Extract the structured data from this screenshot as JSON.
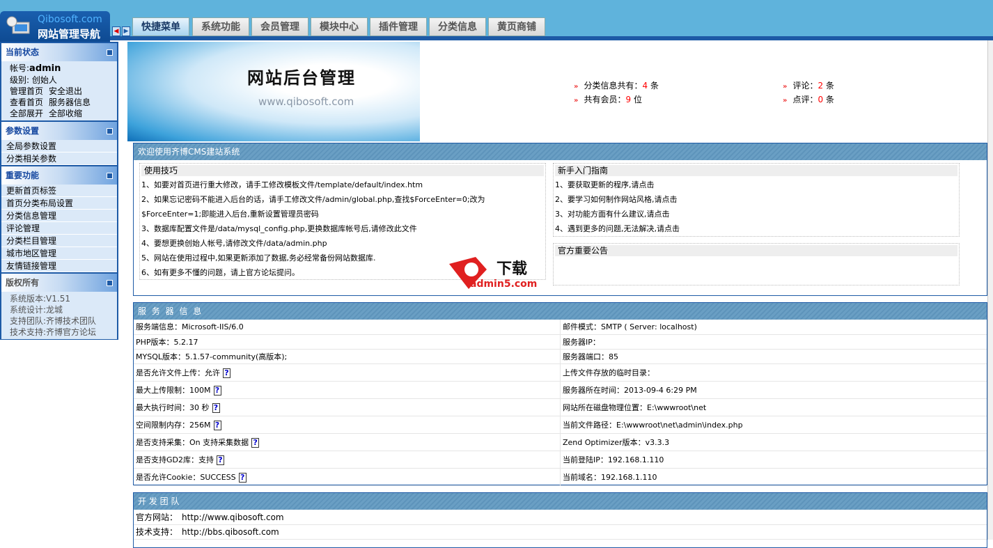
{
  "header": {
    "logo_en": "Qibosoft.com",
    "logo_cn": "网站管理导航",
    "tabs": [
      "快捷菜单",
      "系统功能",
      "会员管理",
      "模块中心",
      "插件管理",
      "分类信息",
      "黄页商铺"
    ],
    "active_tab": 0
  },
  "sidebar": {
    "status": {
      "title": "当前状态",
      "account_label": "帐号:",
      "account": "admin",
      "level": "级别:  创始人",
      "links": [
        [
          "管理首页",
          "安全退出"
        ],
        [
          "查看首页",
          "服务器信息"
        ],
        [
          "全部展开",
          "全部收缩"
        ]
      ]
    },
    "params": {
      "title": "参数设置",
      "items": [
        "全局参数设置",
        "分类相关参数"
      ]
    },
    "important": {
      "title": "重要功能",
      "items": [
        "更新首页标签",
        "首页分类布局设置",
        "分类信息管理",
        "评论管理",
        "分类栏目管理",
        "城市地区管理",
        "友情链接管理"
      ]
    },
    "copyright": {
      "title": "版权所有",
      "lines": [
        "系统版本:V1.51",
        "系统设计:龙城",
        "支持团队:齐博技术团队",
        "技术支持:齐博官方论坛"
      ]
    }
  },
  "banner": {
    "title": "网站后台管理",
    "url": "www.qibosoft.com"
  },
  "stats": [
    {
      "label": "分类信息共有：",
      "value": "4",
      "unit": " 条"
    },
    {
      "label": "共有会员：",
      "value": "9",
      "unit": " 位"
    },
    {
      "label": "评论：",
      "value": "2",
      "unit": " 条"
    },
    {
      "label": "点评：",
      "value": "0",
      "unit": " 条"
    }
  ],
  "welcome": {
    "title": "欢迎使用齐博CMS建站系统",
    "tips": {
      "title": "使用技巧",
      "lines": [
        "1、如要对首页进行重大修改，请手工修改模板文件/template/default/index.htm",
        "2、如果忘记密码不能进入后台的话，请手工修改文件/admin/global.php,查找$ForceEnter=0;改为",
        "$ForceEnter=1;即能进入后台,重新设置管理员密码",
        "3、数据库配置文件是/data/mysql_config.php,更换数据库帐号后,请修改此文件",
        "4、要想更换创始人帐号,请修改文件/data/admin.php",
        "5、网站在使用过程中,如果更新添加了数据,务必经常备份网站数据库.",
        "6、如有更多不懂的问题，请上官方论坛提问。"
      ]
    },
    "guide": {
      "title": "新手入门指南",
      "lines": [
        "1、要获取更新的程序,请点击",
        "2、要学习如何制作网站风格,请点击",
        "3、对功能方面有什么建议,请点击",
        "4、遇到更多的问题,无法解决,请点击"
      ]
    },
    "notice": {
      "title": "官方重要公告"
    },
    "watermark": "admin5.com 下载"
  },
  "server": {
    "title": "服 务 器 信 息",
    "rows": [
      [
        "服务端信息：Microsoft-IIS/6.0",
        "邮件模式：SMTP ( Server: localhost)",
        false
      ],
      [
        "PHP版本：5.2.17",
        "服务器IP：",
        false
      ],
      [
        "MYSQL版本：5.1.57-community(高版本);",
        "服务器端口：85",
        false
      ],
      [
        "是否允许文件上传：允许",
        "上传文件存放的临时目录：",
        true
      ],
      [
        "最大上传限制：100M",
        "服务器所在时间：2013-09-4 6:29 PM",
        true
      ],
      [
        "最大执行时间：30 秒",
        "网站所在磁盘物理位置：E:\\wwwroot\\net",
        true
      ],
      [
        "空间限制内存：256M",
        "当前文件路径：E:\\wwwroot\\net\\admin\\index.php",
        true
      ],
      [
        "是否支持采集：On 支持采集数据",
        "Zend Optimizer版本：v3.3.3",
        true
      ],
      [
        "是否支持GD2库：支持",
        "当前登陆IP：192.168.1.110",
        true
      ],
      [
        "是否允许Cookie：SUCCESS",
        "当前域名：192.168.1.110",
        true
      ]
    ],
    "help": "?"
  },
  "team": {
    "title": "开 发 团 队",
    "rows": [
      [
        "官方网站：",
        "http://www.qibosoft.com"
      ],
      [
        "技术支持：",
        "http://bbs.qibosoft.com"
      ]
    ]
  }
}
